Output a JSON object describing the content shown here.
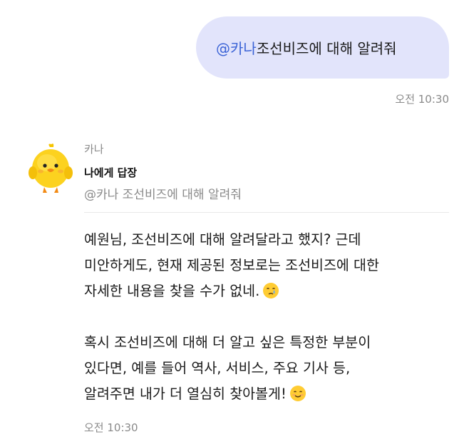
{
  "user_message": {
    "mention": "@카나",
    "text": " 조선비즈에 대해 알려줘",
    "time": "오전 10:30"
  },
  "bot": {
    "name": "카나",
    "avatar_icon": "yellow-chick-icon",
    "reply_label": "나에게 답장",
    "reply_quote": "@카나 조선비즈에 대해 알려줘",
    "lines": [
      "예원님, 조선비즈에 대해 알려달라고 했지? 근데",
      "미안하게도, 현재 제공된 정보로는 조선비즈에 대한",
      "자세한 내용을 찾을 수가 없네.",
      "혹시 조선비즈에 대해 더 알고 싶은 특정한 부분이",
      "있다면, 예를 들어 역사, 서비스, 주요 기사 등,",
      "알려주면 내가 더 열심히 찾아볼게!"
    ],
    "emoji_1": "crying-face-emoji",
    "emoji_2": "smiling-face-emoji",
    "time": "오전 10:30"
  },
  "colors": {
    "user_bubble": "#e2e4fb",
    "mention": "#3b63d6",
    "timestamp": "#8a8a8a"
  }
}
